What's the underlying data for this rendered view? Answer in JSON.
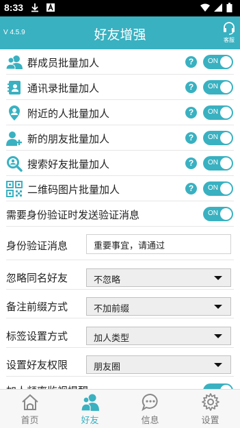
{
  "status_bar": {
    "time": "8:33"
  },
  "header": {
    "version": "V 4.5.9",
    "title": "好友增强",
    "service_label": "客服"
  },
  "features": [
    {
      "label": "群成员批量加人",
      "help": "?",
      "toggle": "ON",
      "icon": "group-members-icon"
    },
    {
      "label": "通讯录批量加人",
      "help": "?",
      "toggle": "ON",
      "icon": "contacts-book-icon"
    },
    {
      "label": "附近的人批量加人",
      "help": "?",
      "toggle": "ON",
      "icon": "nearby-people-icon"
    },
    {
      "label": "新的朋友批量加人",
      "help": "?",
      "toggle": "ON",
      "icon": "new-friend-icon"
    },
    {
      "label": "搜索好友批量加人",
      "help": "?",
      "toggle": "ON",
      "icon": "search-friend-icon"
    },
    {
      "label": "二维码图片批量加人",
      "help": "?",
      "toggle": "ON",
      "icon": "qr-code-icon"
    }
  ],
  "verify_send": {
    "label": "需要身份验证时发送验证消息",
    "toggle": "ON"
  },
  "verify_message": {
    "label": "身份验证消息",
    "value": "重要事宜，请通过"
  },
  "settings": [
    {
      "label": "忽略同名好友",
      "value": "不忽略"
    },
    {
      "label": "备注前缀方式",
      "value": "不加前缀"
    },
    {
      "label": "标签设置方式",
      "value": "加人类型"
    },
    {
      "label": "设置好友权限",
      "value": "朋友圈"
    }
  ],
  "partial_row": {
    "label": "加人频率监视提醒"
  },
  "accent_color": "#39b1c1",
  "nav": [
    {
      "label": "首页",
      "icon": "home-icon",
      "active": false
    },
    {
      "label": "好友",
      "icon": "friends-icon",
      "active": true
    },
    {
      "label": "信息",
      "icon": "message-icon",
      "active": false
    },
    {
      "label": "设置",
      "icon": "settings-gear-icon",
      "active": false
    }
  ]
}
